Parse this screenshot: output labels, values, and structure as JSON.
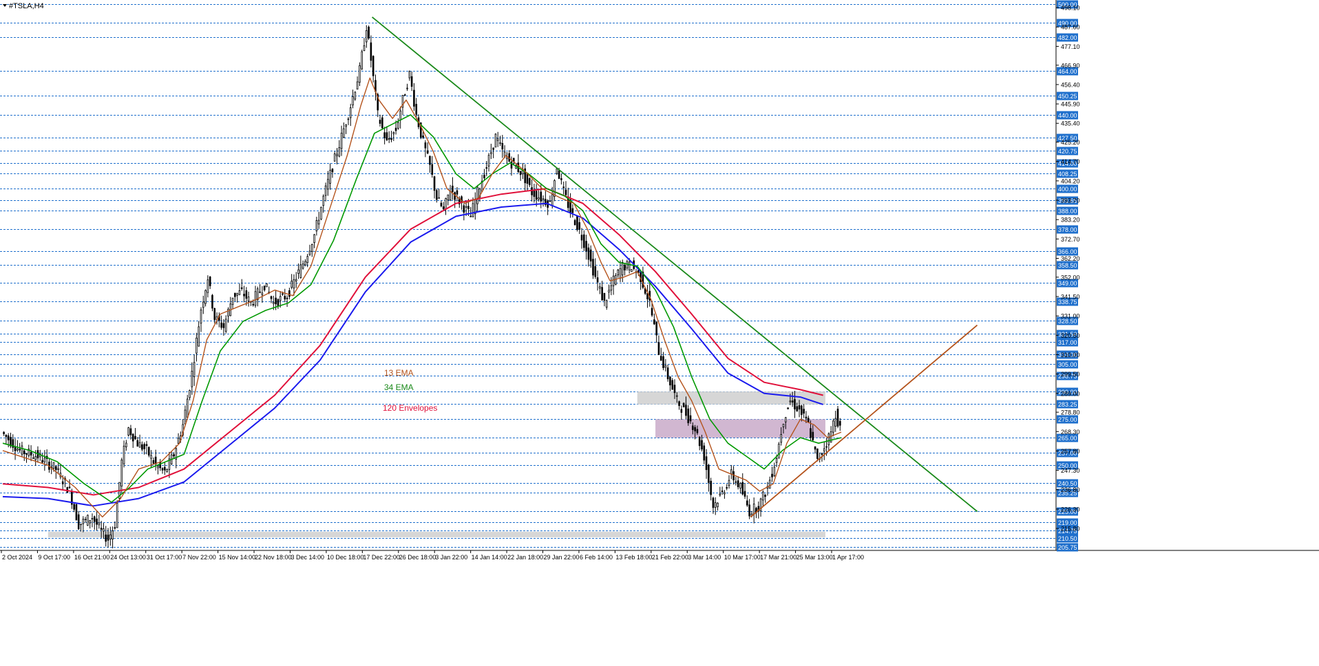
{
  "chart_data": {
    "type": "candlestick",
    "symbol_label": "#TSLA,H4",
    "y_axis": {
      "min": 205.75,
      "max": 500,
      "level_labels": [
        "500.00",
        "490.00",
        "482.00",
        "464.00",
        "450.25",
        "440.00",
        "427.50",
        "420.75",
        "414.00",
        "408.25",
        "400.00",
        "393.65",
        "388.00",
        "378.00",
        "366.00",
        "358.50",
        "349.00",
        "338.75",
        "328.50",
        "321.50",
        "317.00",
        "310.00",
        "305.00",
        "298.75",
        "290.00",
        "283.25",
        "275.00",
        "265.00",
        "257.00",
        "250.00",
        "240.50",
        "235.25",
        "225.00",
        "219.00",
        "214.75",
        "210.50",
        "205.75"
      ],
      "tick_labels": [
        "498.10",
        "487.60",
        "477.10",
        "466.90",
        "456.40",
        "445.90",
        "435.40",
        "425.20",
        "414.70",
        "404.20",
        "393.70",
        "383.20",
        "372.70",
        "362.20",
        "352.00",
        "341.50",
        "331.00",
        "320.50",
        "310.00",
        "299.50",
        "289.00",
        "278.80",
        "268.30",
        "257.80",
        "247.30",
        "236.80",
        "226.30",
        "215.80"
      ],
      "level_color": "#1e6fcc"
    },
    "x_axis": {
      "labels": [
        "2 Oct 2024",
        "9 Oct 17:00",
        "16 Oct 21:00",
        "24 Oct 13:00",
        "31 Oct 17:00",
        "7 Nov 22:00",
        "15 Nov 14:00",
        "22 Nov 18:00",
        "3 Dec 14:00",
        "10 Dec 18:00",
        "17 Dec 22:00",
        "26 Dec 18:00",
        "3 Jan 22:00",
        "14 Jan 14:00",
        "22 Jan 18:00",
        "29 Jan 22:00",
        "6 Feb 14:00",
        "13 Feb 18:00",
        "21 Feb 22:00",
        "3 Mar 14:00",
        "10 Mar 17:00",
        "17 Mar 21:00",
        "25 Mar 13:00",
        "1 Apr 17:00"
      ]
    },
    "price_path": [
      [
        0,
        268
      ],
      [
        8,
        258
      ],
      [
        16,
        255
      ],
      [
        24,
        248
      ],
      [
        30,
        236
      ],
      [
        34,
        218
      ],
      [
        40,
        222
      ],
      [
        44,
        214
      ],
      [
        47,
        210
      ],
      [
        50,
        218
      ],
      [
        53,
        252
      ],
      [
        56,
        270
      ],
      [
        60,
        262
      ],
      [
        64,
        258
      ],
      [
        68,
        250
      ],
      [
        72,
        246
      ],
      [
        76,
        256
      ],
      [
        80,
        272
      ],
      [
        84,
        300
      ],
      [
        88,
        335
      ],
      [
        91,
        352
      ],
      [
        94,
        330
      ],
      [
        98,
        325
      ],
      [
        102,
        342
      ],
      [
        106,
        344
      ],
      [
        110,
        338
      ],
      [
        116,
        348
      ],
      [
        120,
        338
      ],
      [
        126,
        342
      ],
      [
        130,
        352
      ],
      [
        134,
        362
      ],
      [
        138,
        375
      ],
      [
        142,
        395
      ],
      [
        146,
        412
      ],
      [
        150,
        428
      ],
      [
        154,
        445
      ],
      [
        158,
        464
      ],
      [
        161,
        488
      ],
      [
        163,
        470
      ],
      [
        166,
        440
      ],
      [
        170,
        425
      ],
      [
        174,
        432
      ],
      [
        177,
        448
      ],
      [
        180,
        462
      ],
      [
        183,
        440
      ],
      [
        186,
        425
      ],
      [
        189,
        412
      ],
      [
        192,
        395
      ],
      [
        195,
        388
      ],
      [
        198,
        400
      ],
      [
        201,
        395
      ],
      [
        204,
        390
      ],
      [
        207,
        385
      ],
      [
        210,
        398
      ],
      [
        214,
        412
      ],
      [
        218,
        428
      ],
      [
        221,
        420
      ],
      [
        224,
        415
      ],
      [
        227,
        412
      ],
      [
        230,
        408
      ],
      [
        234,
        398
      ],
      [
        238,
        395
      ],
      [
        242,
        392
      ],
      [
        245,
        412
      ],
      [
        248,
        398
      ],
      [
        251,
        388
      ],
      [
        254,
        380
      ],
      [
        258,
        368
      ],
      [
        262,
        352
      ],
      [
        266,
        338
      ],
      [
        270,
        350
      ],
      [
        274,
        358
      ],
      [
        278,
        358
      ],
      [
        282,
        352
      ],
      [
        286,
        338
      ],
      [
        290,
        312
      ],
      [
        294,
        298
      ],
      [
        298,
        285
      ],
      [
        302,
        278
      ],
      [
        306,
        270
      ],
      [
        310,
        255
      ],
      [
        314,
        228
      ],
      [
        318,
        235
      ],
      [
        322,
        245
      ],
      [
        326,
        238
      ],
      [
        330,
        225
      ],
      [
        334,
        228
      ],
      [
        338,
        238
      ],
      [
        342,
        255
      ],
      [
        345,
        275
      ],
      [
        348,
        285
      ],
      [
        352,
        280
      ],
      [
        356,
        272
      ],
      [
        360,
        252
      ],
      [
        363,
        260
      ],
      [
        366,
        268
      ],
      [
        368,
        278
      ],
      [
        370,
        270
      ]
    ],
    "ema13_path": [
      [
        0,
        258
      ],
      [
        10,
        254
      ],
      [
        20,
        250
      ],
      [
        32,
        238
      ],
      [
        44,
        222
      ],
      [
        52,
        232
      ],
      [
        60,
        248
      ],
      [
        70,
        252
      ],
      [
        78,
        262
      ],
      [
        84,
        285
      ],
      [
        90,
        318
      ],
      [
        96,
        332
      ],
      [
        104,
        336
      ],
      [
        112,
        340
      ],
      [
        120,
        345
      ],
      [
        128,
        342
      ],
      [
        136,
        358
      ],
      [
        144,
        388
      ],
      [
        152,
        418
      ],
      [
        158,
        445
      ],
      [
        162,
        460
      ],
      [
        166,
        448
      ],
      [
        172,
        438
      ],
      [
        178,
        448
      ],
      [
        184,
        435
      ],
      [
        190,
        420
      ],
      [
        196,
        400
      ],
      [
        204,
        392
      ],
      [
        210,
        395
      ],
      [
        216,
        408
      ],
      [
        222,
        418
      ],
      [
        230,
        410
      ],
      [
        238,
        400
      ],
      [
        246,
        395
      ],
      [
        252,
        392
      ],
      [
        258,
        378
      ],
      [
        264,
        360
      ],
      [
        268,
        350
      ],
      [
        274,
        352
      ],
      [
        280,
        355
      ],
      [
        286,
        340
      ],
      [
        292,
        318
      ],
      [
        298,
        298
      ],
      [
        304,
        285
      ],
      [
        310,
        268
      ],
      [
        316,
        248
      ],
      [
        322,
        245
      ],
      [
        328,
        242
      ],
      [
        334,
        236
      ],
      [
        340,
        240
      ],
      [
        346,
        262
      ],
      [
        352,
        275
      ],
      [
        358,
        272
      ],
      [
        364,
        265
      ],
      [
        370,
        268
      ]
    ],
    "ema34_path": [
      [
        0,
        262
      ],
      [
        12,
        258
      ],
      [
        24,
        252
      ],
      [
        36,
        240
      ],
      [
        48,
        230
      ],
      [
        56,
        238
      ],
      [
        64,
        248
      ],
      [
        72,
        252
      ],
      [
        80,
        256
      ],
      [
        88,
        285
      ],
      [
        96,
        312
      ],
      [
        106,
        328
      ],
      [
        116,
        334
      ],
      [
        126,
        338
      ],
      [
        136,
        348
      ],
      [
        146,
        372
      ],
      [
        156,
        405
      ],
      [
        164,
        430
      ],
      [
        172,
        435
      ],
      [
        180,
        440
      ],
      [
        190,
        428
      ],
      [
        200,
        408
      ],
      [
        208,
        400
      ],
      [
        216,
        408
      ],
      [
        224,
        414
      ],
      [
        232,
        408
      ],
      [
        240,
        400
      ],
      [
        248,
        396
      ],
      [
        256,
        388
      ],
      [
        264,
        370
      ],
      [
        272,
        360
      ],
      [
        280,
        358
      ],
      [
        288,
        345
      ],
      [
        296,
        325
      ],
      [
        304,
        298
      ],
      [
        312,
        275
      ],
      [
        320,
        262
      ],
      [
        328,
        255
      ],
      [
        336,
        248
      ],
      [
        344,
        258
      ],
      [
        352,
        265
      ],
      [
        360,
        262
      ],
      [
        370,
        265
      ]
    ],
    "env_upper_path": [
      [
        0,
        240
      ],
      [
        20,
        238
      ],
      [
        40,
        234
      ],
      [
        60,
        238
      ],
      [
        80,
        248
      ],
      [
        100,
        268
      ],
      [
        120,
        288
      ],
      [
        140,
        315
      ],
      [
        160,
        352
      ],
      [
        180,
        378
      ],
      [
        200,
        392
      ],
      [
        220,
        397
      ],
      [
        240,
        400
      ],
      [
        256,
        392
      ],
      [
        272,
        375
      ],
      [
        288,
        355
      ],
      [
        304,
        332
      ],
      [
        320,
        308
      ],
      [
        336,
        295
      ],
      [
        352,
        291
      ],
      [
        362,
        288
      ]
    ],
    "env_lower_path": [
      [
        0,
        233
      ],
      [
        20,
        232
      ],
      [
        40,
        228
      ],
      [
        60,
        232
      ],
      [
        80,
        241
      ],
      [
        100,
        261
      ],
      [
        120,
        281
      ],
      [
        140,
        307
      ],
      [
        160,
        344
      ],
      [
        180,
        371
      ],
      [
        200,
        385
      ],
      [
        220,
        390
      ],
      [
        240,
        392
      ],
      [
        256,
        384
      ],
      [
        272,
        367
      ],
      [
        288,
        347
      ],
      [
        304,
        324
      ],
      [
        320,
        300
      ],
      [
        336,
        289
      ],
      [
        352,
        287
      ],
      [
        362,
        283
      ]
    ],
    "trendlines": [
      {
        "name": "resistance",
        "color": "#1b8a1b",
        "from": [
          163,
          493
        ],
        "to": [
          430,
          225
        ]
      },
      {
        "name": "support",
        "color": "#b4531c",
        "from": [
          330,
          222
        ],
        "to": [
          430,
          326
        ]
      }
    ],
    "zones": [
      {
        "color": "#cfcfcf",
        "x": [
          280,
          363
        ],
        "y": [
          283,
          290
        ]
      },
      {
        "color": "#c9aac9",
        "x": [
          288,
          363
        ],
        "y": [
          265,
          275
        ]
      },
      {
        "color": "#cfcfcf",
        "x": [
          20,
          363
        ],
        "y": [
          211,
          214
        ]
      }
    ],
    "legend": [
      {
        "text": "13 EMA",
        "color": "#b4531c"
      },
      {
        "text": "34 EMA",
        "color": "#1b8a1b"
      },
      {
        "text": "120 Envelopes",
        "color": "#e0103a"
      }
    ],
    "colors": {
      "ema13": "#b4531c",
      "ema34": "#009900",
      "env_upper": "#e0103a",
      "env_lower": "#1a1aee",
      "candles": "#000000"
    }
  }
}
